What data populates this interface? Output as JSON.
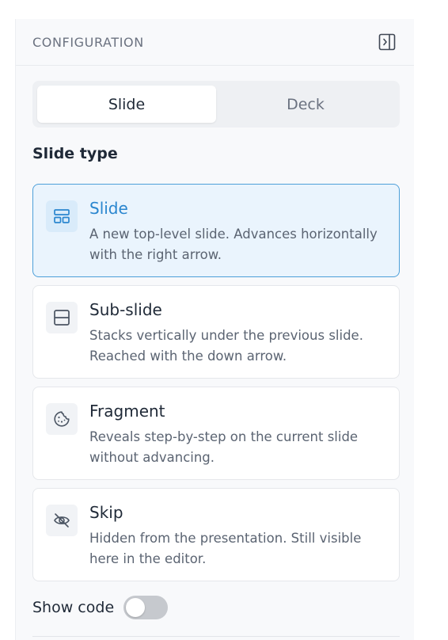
{
  "panel": {
    "title": "CONFIGURATION",
    "collapse_icon": "sidebar-collapse-icon"
  },
  "tabs": [
    {
      "label": "Slide",
      "active": true
    },
    {
      "label": "Deck",
      "active": false
    }
  ],
  "slide_type": {
    "label": "Slide type",
    "options": [
      {
        "title": "Slide",
        "description": "A new top-level slide. Advances horizontally with the right arrow.",
        "icon": "layout-grid-icon",
        "selected": true
      },
      {
        "title": "Sub-slide",
        "description": "Stacks vertically under the previous slide. Reached with the down arrow.",
        "icon": "split-rows-icon",
        "selected": false
      },
      {
        "title": "Fragment",
        "description": "Reveals step-by-step on the current slide without advancing.",
        "icon": "cookie-icon",
        "selected": false
      },
      {
        "title": "Skip",
        "description": "Hidden from the presentation. Still visible here in the editor.",
        "icon": "eye-off-icon",
        "selected": false
      }
    ]
  },
  "show_code": {
    "label": "Show code",
    "enabled": false
  },
  "colors": {
    "accent": "#2a86cf",
    "selected_bg": "#eaf4fd",
    "selected_border": "#4d9fd9"
  }
}
